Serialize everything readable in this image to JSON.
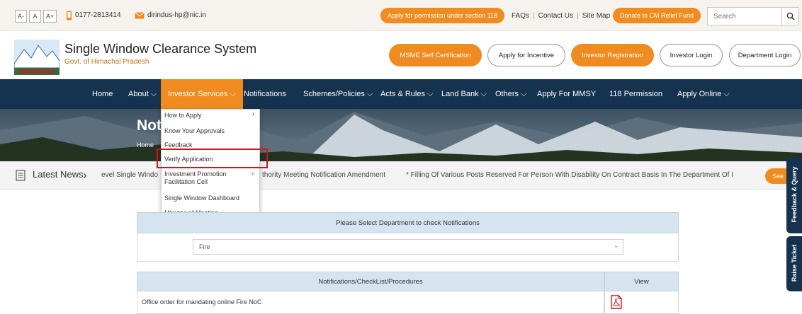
{
  "topbar": {
    "font_buttons": [
      "A-",
      "A",
      "A+"
    ],
    "phone": "0177-2813414",
    "email": "dirindus-hp@nic.in",
    "permission_button": "Apply for permission under section 118",
    "links": [
      "FAQs",
      "Contact Us",
      "Site Map"
    ],
    "donate_button": "Donate to CM Relief Fund",
    "search_placeholder": "Search"
  },
  "header": {
    "title": "Single Window Clearance System",
    "subtitle": "Govt. of Himachal Pradesh",
    "buttons": [
      {
        "label": "MSME Self Certification",
        "style": "orange"
      },
      {
        "label": "Apply for Incentive",
        "style": "outline"
      },
      {
        "label": "Investor Registration",
        "style": "orange"
      },
      {
        "label": "Investor Login",
        "style": "outline"
      },
      {
        "label": "Department Login",
        "style": "outline"
      }
    ]
  },
  "nav": {
    "items": [
      {
        "label": "Home"
      },
      {
        "label": "About ⌵"
      },
      {
        "label": "Investor Services ⌵",
        "active": true
      },
      {
        "label": "Notifications"
      },
      {
        "label": "Schemes/Policies ⌵"
      },
      {
        "label": "Acts & Rules ⌵"
      },
      {
        "label": "Land Bank ⌵"
      },
      {
        "label": "Others ⌵"
      },
      {
        "label": "Apply For MMSY"
      },
      {
        "label": "118 Permission"
      },
      {
        "label": "Apply Online ⌵"
      }
    ]
  },
  "hero": {
    "title": "Not",
    "breadcrumb": "Home"
  },
  "dropdown": {
    "items": [
      {
        "label": "How to Apply",
        "has_submenu": true
      },
      {
        "label": "Know Your Approvals"
      },
      {
        "label": "Feedback"
      },
      {
        "label": "Verify Application",
        "highlighted": true
      },
      {
        "label": "Investment Promotion",
        "has_submenu": true
      },
      {
        "label": "Facilitation Cell"
      },
      {
        "label": "Single Window Dashboard"
      },
      {
        "label": "Minutes of Meeting"
      }
    ]
  },
  "news": {
    "label": "Latest News",
    "fragment_left": "evel Single Windo",
    "fragment_mid": "thority Meeting Notification Amendment",
    "item_2": "* Filling Of Various Posts Reserved For Person With Disability On Contract Basis In The Department Of I",
    "see_button": "See"
  },
  "department_panel": {
    "heading": "Please Select Department to check Notifications",
    "selected": "Fire"
  },
  "table": {
    "headers": [
      "Notifications/CheckList/Procedures",
      "View"
    ],
    "rows": [
      {
        "text": "Office order for mandating online Fire NoC",
        "view_icon": "pdf-icon"
      }
    ]
  },
  "side_tabs": [
    "Feedback & Query",
    "Raise Ticket"
  ],
  "colors": {
    "accent_orange": "#f08c1f",
    "nav_navy": "#15324f",
    "panel_blue": "#d6e4f0",
    "highlight_red": "#d0151d"
  }
}
